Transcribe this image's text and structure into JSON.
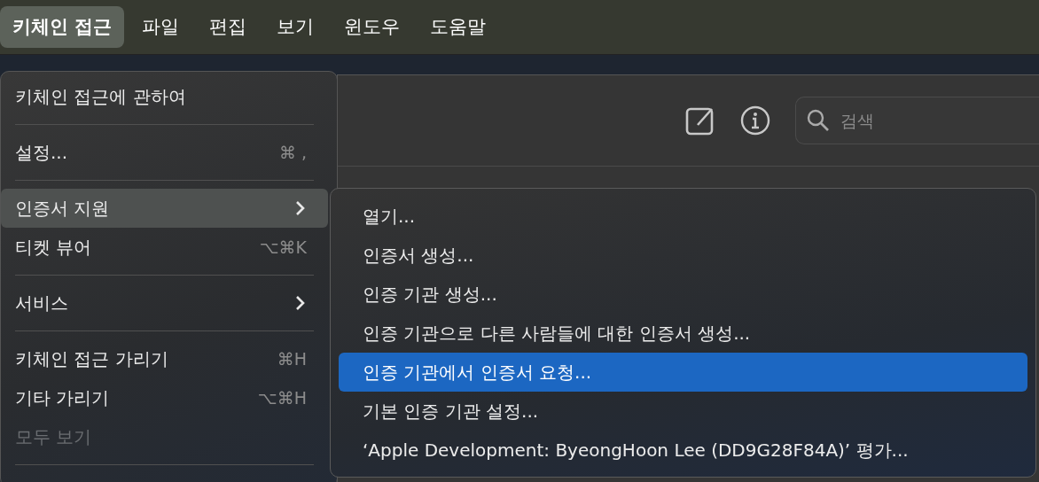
{
  "menu_bar": [
    {
      "label": "키체인 접근",
      "selected": true
    },
    {
      "label": "파일",
      "selected": false
    },
    {
      "label": "편집",
      "selected": false
    },
    {
      "label": "보기",
      "selected": false
    },
    {
      "label": "윈도우",
      "selected": false
    },
    {
      "label": "도움말",
      "selected": false
    }
  ],
  "toolbar": {
    "search": {
      "placeholder": "검색"
    }
  },
  "app_menu": [
    {
      "kind": "item",
      "label": "키체인 접근에 관하여",
      "selected": false,
      "disabled": false,
      "submenu": false
    },
    {
      "kind": "separator"
    },
    {
      "kind": "item",
      "label": "설정...",
      "shortcut": "⌘ ,",
      "selected": false,
      "disabled": false,
      "submenu": false
    },
    {
      "kind": "separator"
    },
    {
      "kind": "item",
      "label": "인증서 지원",
      "selected": true,
      "disabled": false,
      "submenu": true
    },
    {
      "kind": "item",
      "label": "티켓 뷰어",
      "shortcut": "⌥⌘K",
      "selected": false,
      "disabled": false,
      "submenu": false
    },
    {
      "kind": "separator"
    },
    {
      "kind": "item",
      "label": "서비스",
      "selected": false,
      "disabled": false,
      "submenu": true
    },
    {
      "kind": "separator"
    },
    {
      "kind": "item",
      "label": "키체인 접근 가리기",
      "shortcut": "⌘H",
      "selected": false,
      "disabled": false,
      "submenu": false
    },
    {
      "kind": "item",
      "label": "기타 가리기",
      "shortcut": "⌥⌘H",
      "selected": false,
      "disabled": false,
      "submenu": false
    },
    {
      "kind": "item",
      "label": "모두 보기",
      "selected": false,
      "disabled": true,
      "submenu": false
    },
    {
      "kind": "separator"
    }
  ],
  "submenu": [
    {
      "label": "열기...",
      "selected": false
    },
    {
      "label": "인증서 생성...",
      "selected": false
    },
    {
      "label": "인증 기관 생성...",
      "selected": false
    },
    {
      "label": "인증 기관으로 다른 사람들에 대한 인증서 생성...",
      "selected": false
    },
    {
      "label": "인증 기관에서 인증서 요청...",
      "selected": true
    },
    {
      "label": "기본 인증 기관 설정...",
      "selected": false
    },
    {
      "label": "‘Apple Development: ByeongHoon Lee (DD9G28F84A)’ 평가...",
      "selected": false
    }
  ]
}
